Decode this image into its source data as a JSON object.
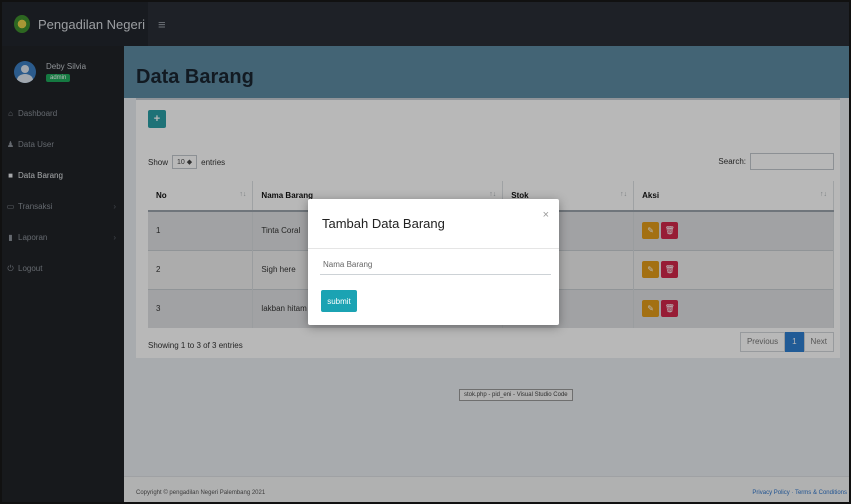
{
  "app": {
    "brand": "Pengadilan Negeri",
    "menu_toggle": "≡"
  },
  "user": {
    "name": "Deby Silvia",
    "role": "admin"
  },
  "sidebar": {
    "items": [
      {
        "icon": "⌂",
        "label": "Dashboard"
      },
      {
        "icon": "♟",
        "label": "Data User"
      },
      {
        "icon": "■",
        "label": "Data Barang"
      },
      {
        "icon": "▭",
        "label": "Transaksi",
        "chevron": "›"
      },
      {
        "icon": "▮",
        "label": "Laporan",
        "chevron": "›"
      },
      {
        "icon": "⏻",
        "label": "Logout"
      }
    ]
  },
  "page": {
    "title": "Data Barang"
  },
  "toolbar": {
    "add_label": "+"
  },
  "table_controls": {
    "show_label": "Show",
    "page_length": "10 ◆",
    "entries_label": "entries",
    "search_label": "Search:"
  },
  "table": {
    "headers": [
      "No",
      "Nama Barang",
      "Stok",
      "Aksi"
    ],
    "sort_glyph": "↑↓",
    "rows": [
      {
        "no": "1",
        "nama": "Tinta Coral",
        "stok": ""
      },
      {
        "no": "2",
        "nama": "Sigh here",
        "stok": ""
      },
      {
        "no": "3",
        "nama": "lakban hitam",
        "stok": ""
      }
    ],
    "edit_glyph": "✎",
    "delete_glyph": "🗑"
  },
  "pagination": {
    "info": "Showing 1 to 3 of 3 entries",
    "previous": "Previous",
    "current": "1",
    "next": "Next"
  },
  "tooltip": {
    "text": "stok.php - pid_eni - Visual Studio Code"
  },
  "footer": {
    "copyright": "Copyright © pengadilan Negeri Palembang 2021",
    "links": "Privacy Policy · Terms & Conditions"
  },
  "modal": {
    "title": "Tambah Data Barang",
    "close": "×",
    "input_placeholder": "Nama Barang",
    "input_value": "",
    "submit_label": "submit"
  },
  "colors": {
    "accent": "#1ba3b3",
    "edit": "#e29c1a",
    "delete": "#d2284a",
    "badge": "#1ea85a",
    "page_active": "#2f7fd0"
  }
}
